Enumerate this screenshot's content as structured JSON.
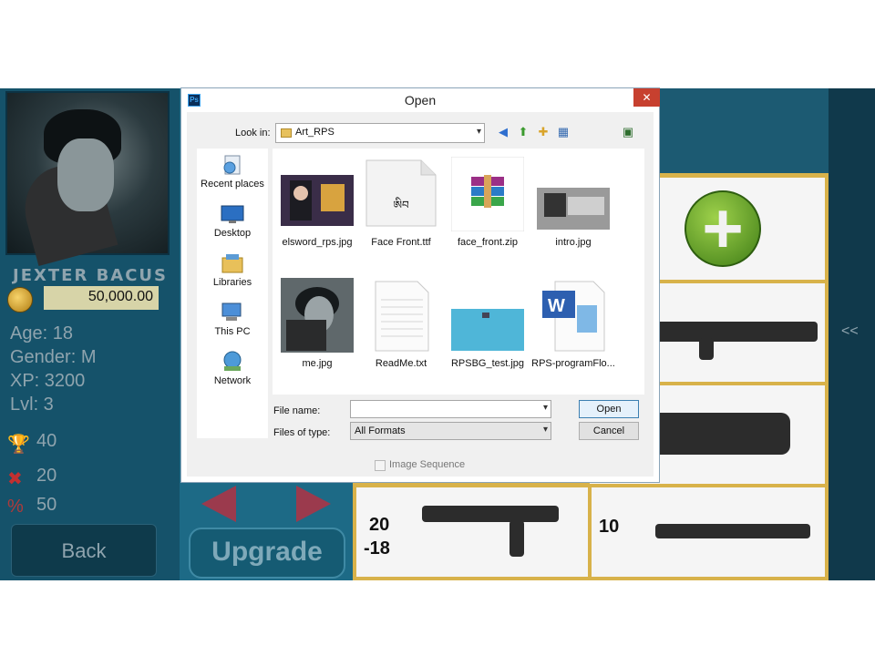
{
  "game": {
    "player_name": "JEXTER BACUS",
    "coins": "50,000.00",
    "age": "Age: 18",
    "gender": "Gender: M",
    "xp": "XP: 3200",
    "level": "Lvl: 3",
    "wins": "40",
    "losses": "20",
    "percent": "50",
    "back_label": "Back",
    "upgrade_label": "Upgrade",
    "cell_stats_left": [
      "20",
      "-18"
    ],
    "cell_stats_right": "10",
    "collapse_glyph": "<<"
  },
  "dialog": {
    "title": "Open",
    "app_icon": "Ps",
    "close_glyph": "✕",
    "look_in_label": "Look in:",
    "look_in_value": "Art_RPS",
    "places": [
      {
        "label": "Recent places",
        "icon": "recent-places-icon"
      },
      {
        "label": "Desktop",
        "icon": "desktop-icon"
      },
      {
        "label": "Libraries",
        "icon": "libraries-icon"
      },
      {
        "label": "This PC",
        "icon": "this-pc-icon"
      },
      {
        "label": "Network",
        "icon": "network-icon"
      }
    ],
    "files": [
      {
        "name": "elsword_rps.jpg",
        "kind": "image"
      },
      {
        "name": "Face Front.ttf",
        "kind": "font"
      },
      {
        "name": "face_front.zip",
        "kind": "archive"
      },
      {
        "name": "intro.jpg",
        "kind": "image"
      },
      {
        "name": "me.jpg",
        "kind": "image"
      },
      {
        "name": "ReadMe.txt",
        "kind": "text"
      },
      {
        "name": "RPSBG_test.jpg",
        "kind": "image"
      },
      {
        "name": "RPS-programFlo...",
        "kind": "word-document"
      }
    ],
    "font_preview_text": "ཨིབ",
    "file_name_label": "File name:",
    "file_name_value": "",
    "files_of_type_label": "Files of type:",
    "files_of_type_value": "All Formats",
    "open_label": "Open",
    "cancel_label": "Cancel",
    "image_sequence_label": "Image Sequence"
  }
}
